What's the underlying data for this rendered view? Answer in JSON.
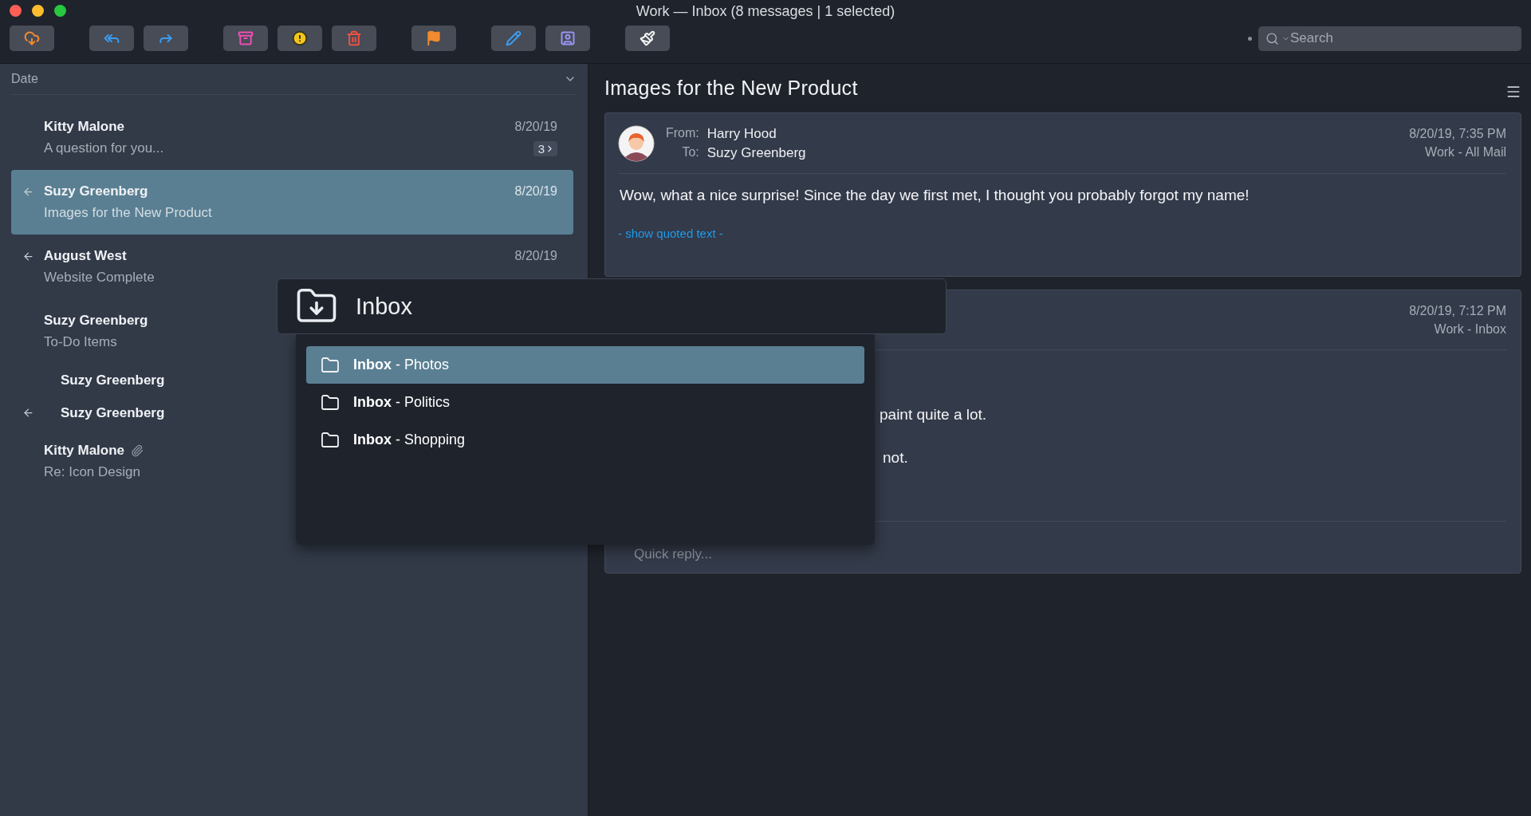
{
  "window": {
    "title": "Work — Inbox (8 messages | 1 selected)"
  },
  "search": {
    "placeholder": "Search"
  },
  "message_list": {
    "sort_label": "Date",
    "messages": [
      {
        "sender": "Kitty Malone",
        "subject": "A question for you...",
        "date": "8/20/19",
        "thread_count": "3",
        "replied": false,
        "selected": false,
        "attachment": false
      },
      {
        "sender": "Suzy Greenberg",
        "subject": "Images for the New Product",
        "date": "8/20/19",
        "replied": true,
        "selected": true,
        "attachment": false
      },
      {
        "sender": "August West",
        "subject": "Website Complete",
        "date": "8/20/19",
        "replied": true,
        "selected": false,
        "attachment": false
      },
      {
        "sender": "Suzy Greenberg",
        "subject": "To-Do Items",
        "replied": false,
        "selected": false,
        "attachment": false,
        "children": [
          {
            "sender": "Suzy Greenberg",
            "replied": false,
            "selected": false
          },
          {
            "sender": "Suzy Greenberg",
            "replied": true,
            "selected": false
          }
        ]
      },
      {
        "sender": "Kitty Malone",
        "subject": "Re: Icon Design",
        "replied": false,
        "selected": false,
        "attachment": true
      }
    ]
  },
  "reading_pane": {
    "subject": "Images for the New Product",
    "messages": [
      {
        "from_label": "From:",
        "from": "Harry Hood",
        "to_label": "To:",
        "to": "Suzy Greenberg",
        "date": "8/20/19, 7:35 PM",
        "folder": "Work - All Mail",
        "body": [
          "Wow, what a nice surprise! Since the day we first met, I thought you probably forgot my name!"
        ],
        "quoted_link": "- show quoted text -"
      },
      {
        "date": "8/20/19, 7:12 PM",
        "folder": "Work - Inbox",
        "body": [
          "paint quite a lot.",
          "not."
        ],
        "quick_reply": {
          "placeholder": "Quick reply..."
        }
      }
    ]
  },
  "move_popup": {
    "title": "Inbox",
    "items": [
      {
        "label": "**Inbox** - Photos",
        "selected": true
      },
      {
        "label": "**Inbox** - Politics",
        "selected": false
      },
      {
        "label": "**Inbox** - Shopping",
        "selected": false
      }
    ]
  }
}
